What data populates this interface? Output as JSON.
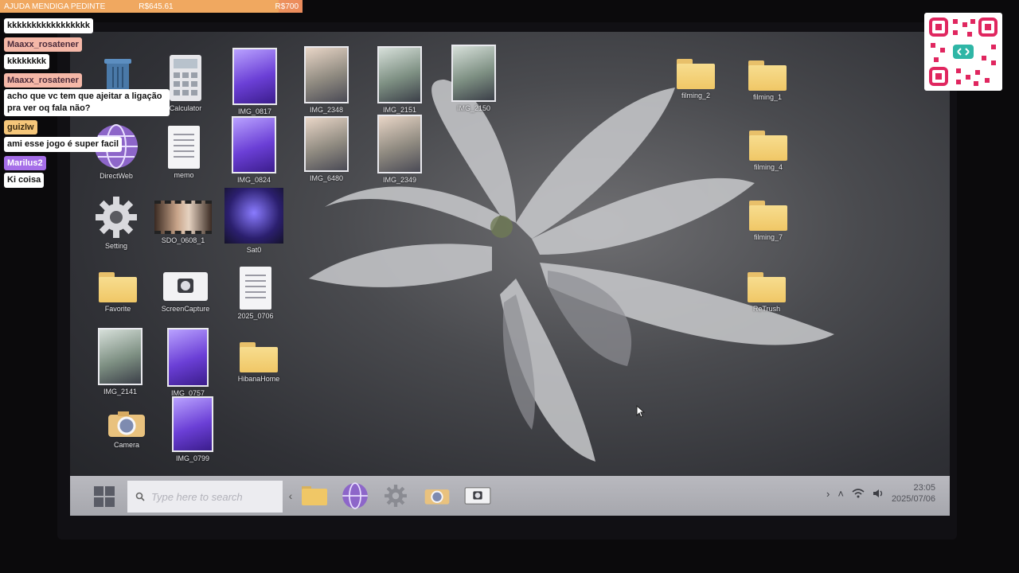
{
  "overlay": {
    "donation_goal": {
      "title": "AJUDA MENDIGA PEDINTE",
      "current": "R$645.61",
      "target": "R$700",
      "progress": 0.922
    },
    "chat": [
      {
        "user": "",
        "text": "kkkkkkkkkkkkkkkkk"
      },
      {
        "user": "Maaxx_rosatener",
        "text": "kkkkkkkk"
      },
      {
        "user": "Maaxx_rosatener",
        "text": "acho que vc tem que ajeitar a ligação pra ver oq fala não?"
      },
      {
        "user": "guizlw",
        "text": "ami esse jogo é super facil"
      },
      {
        "user": "Marilus2",
        "text": "Ki coisa"
      }
    ],
    "colors": {
      "maaxx": "#f5b8a8",
      "guizlw": "#f6c77a",
      "marilus": "#a56ee8"
    }
  },
  "desktop": {
    "icons": {
      "calculator": "Calculator",
      "img0817": "IMG_0817",
      "img2348": "IMG_2348",
      "img2151": "IMG_2151",
      "img2150": "IMG_2150",
      "filming2": "filming_2",
      "filming1": "filming_1",
      "directweb": "DirectWeb",
      "memo": "memo",
      "img0824": "IMG_0824",
      "img6480": "IMG_6480",
      "img2349": "IMG_2349",
      "filming4": "filming_4",
      "setting": "Setting",
      "sdo0608": "SDO_0608_1",
      "sat0": "Sat0",
      "filming7": "filming_7",
      "favorite": "Favorite",
      "screencapture": "ScreenCapture",
      "doc20250706": "2025_0706",
      "retrush": "ReTrush",
      "img2141": "IMG_2141",
      "img0757": "IMG_0757",
      "hibanahome": "HibanaHome",
      "camera": "Camera",
      "img0799": "IMG_0799"
    }
  },
  "taskbar": {
    "search_placeholder": "Type here to search",
    "time": "23:05",
    "date": "2025/07/06"
  }
}
